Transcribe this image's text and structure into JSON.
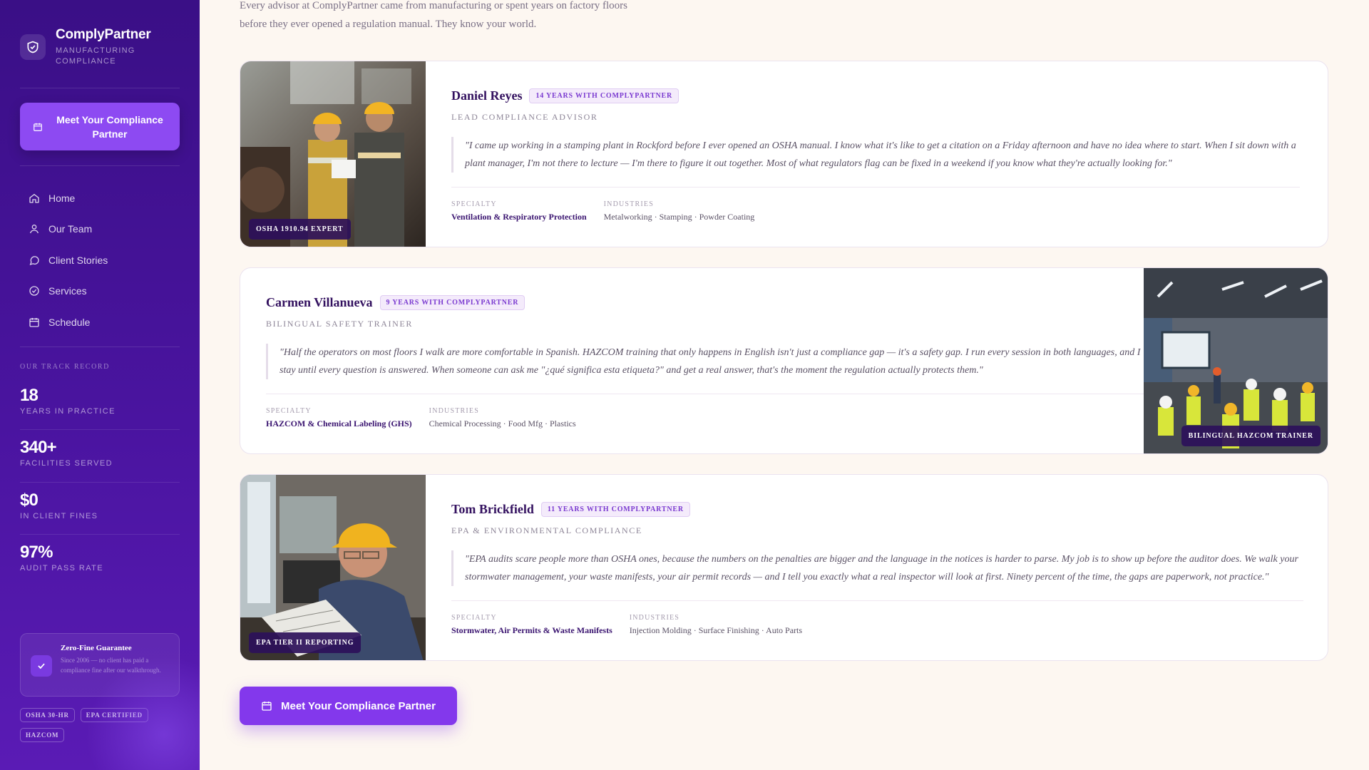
{
  "brand": {
    "name": "ComplyPartner",
    "subtitle": "MANUFACTURING COMPLIANCE"
  },
  "sidebar": {
    "cta_label": "Meet Your Compliance Partner",
    "nav": [
      "Home",
      "Our Team",
      "Client Stories",
      "Services",
      "Schedule"
    ],
    "track_title": "OUR TRACK RECORD",
    "stats": [
      {
        "value": "18",
        "label": "YEARS IN PRACTICE"
      },
      {
        "value": "340+",
        "label": "FACILITIES SERVED"
      },
      {
        "value": "$0",
        "label": "IN CLIENT FINES"
      },
      {
        "value": "97%",
        "label": "AUDIT PASS RATE"
      }
    ],
    "guarantee": {
      "title": "Zero-Fine Guarantee",
      "text": "Since 2006 — no client has paid a compliance fine after our walkthrough."
    },
    "tags": [
      "OSHA 30-HR",
      "EPA CERTIFIED",
      "HAZCOM"
    ]
  },
  "intro": "Every advisor at ComplyPartner came from manufacturing or spent years on factory floors before they ever opened a regulation manual. They know your world.",
  "advisors": [
    {
      "name": "Daniel Reyes",
      "years": "14 YEARS WITH COMPLYPARTNER",
      "role": "LEAD COMPLIANCE ADVISOR",
      "quote": "\"I came up working in a stamping plant in Rockford before I ever opened an OSHA manual. I know what it's like to get a citation on a Friday afternoon and have no idea where to start. When I sit down with a plant manager, I'm not there to lecture — I'm there to figure it out together. Most of what regulators flag can be fixed in a weekend if you know what they're actually looking for.\"",
      "specialty_label": "SPECIALTY",
      "specialty": "Ventilation & Respiratory Protection",
      "industries_label": "INDUSTRIES",
      "industries": "Metalworking · Stamping · Powder Coating",
      "badge": "OSHA 1910.94 EXPERT"
    },
    {
      "name": "Carmen Villanueva",
      "years": "9 YEARS WITH COMPLYPARTNER",
      "role": "BILINGUAL SAFETY TRAINER",
      "quote": "\"Half the operators on most floors I walk are more comfortable in Spanish. HAZCOM training that only happens in English isn't just a compliance gap — it's a safety gap. I run every session in both languages, and I stay until every question is answered. When someone can ask me \"¿qué significa esta etiqueta?\" and get a real answer, that's the moment the regulation actually protects them.\"",
      "specialty_label": "SPECIALTY",
      "specialty": "HAZCOM & Chemical Labeling (GHS)",
      "industries_label": "INDUSTRIES",
      "industries": "Chemical Processing · Food Mfg · Plastics",
      "badge": "BILINGUAL HAZCOM TRAINER"
    },
    {
      "name": "Tom Brickfield",
      "years": "11 YEARS WITH COMPLYPARTNER",
      "role": "EPA & ENVIRONMENTAL COMPLIANCE",
      "quote": "\"EPA audits scare people more than OSHA ones, because the numbers on the penalties are bigger and the language in the notices is harder to parse. My job is to show up before the auditor does. We walk your stormwater management, your waste manifests, your air permit records — and I tell you exactly what a real inspector will look at first. Ninety percent of the time, the gaps are paperwork, not practice.\"",
      "specialty_label": "SPECIALTY",
      "specialty": "Stormwater, Air Permits & Waste Manifests",
      "industries_label": "INDUSTRIES",
      "industries": "Injection Molding · Surface Finishing · Auto Parts",
      "badge": "EPA TIER II REPORTING"
    }
  ],
  "main_cta": "Meet Your Compliance Partner"
}
